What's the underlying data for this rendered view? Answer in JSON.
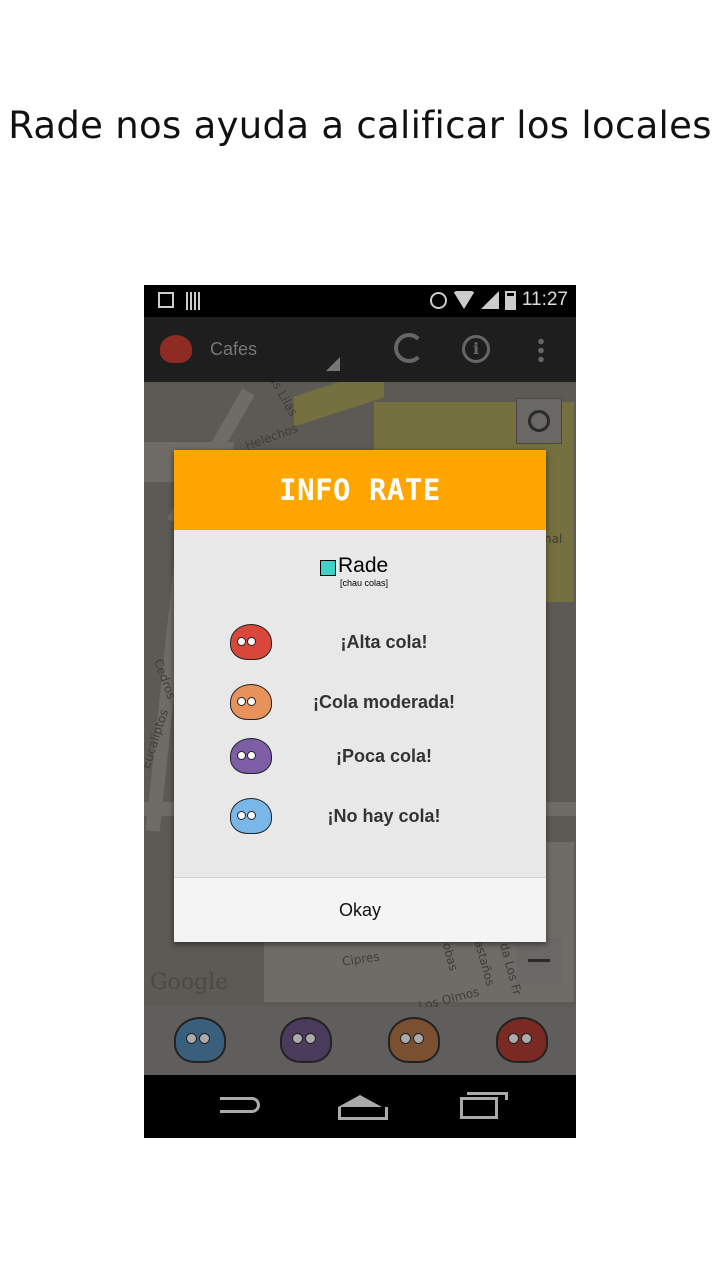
{
  "caption": "Rade nos ayuda a calificar los locales",
  "status_bar": {
    "time": "11:27",
    "icons": [
      "image-icon",
      "barcode-icon",
      "alarm-icon",
      "wifi-icon",
      "signal-icon",
      "battery-icon"
    ]
  },
  "action_bar": {
    "title": "Cafes",
    "icons": [
      "rade-logo-icon",
      "refresh-icon",
      "info-icon",
      "overflow-menu-icon"
    ]
  },
  "map": {
    "labels": [
      "Las Lilas",
      "Helechos",
      "Cipres",
      "Caobas",
      "Castaños",
      "Los Olmos",
      "Eucaliptos",
      "Cedros",
      "nal",
      "da Los Fr"
    ],
    "watermark": "Google"
  },
  "dialog": {
    "title": "INFO RATE",
    "brand": {
      "name": "Rade",
      "tagline": "[chau colas]"
    },
    "levels": [
      {
        "label": "¡Alta cola!",
        "color": "#d9473a",
        "mood": "angry"
      },
      {
        "label": "¡Cola moderada!",
        "color": "#e6925a",
        "mood": "annoyed"
      },
      {
        "label": "¡Poca cola!",
        "color": "#7d5ea6",
        "mood": "sleepy"
      },
      {
        "label": "¡No hay cola!",
        "color": "#79b7e8",
        "mood": "happy"
      }
    ],
    "ok_label": "Okay"
  },
  "bottom_filters": [
    {
      "name": "no-queue",
      "color": "#3a5f7d"
    },
    {
      "name": "little-queue",
      "color": "#4a3a5c"
    },
    {
      "name": "moderate-queue",
      "color": "#7a5030"
    },
    {
      "name": "high-queue",
      "color": "#7a2a22"
    }
  ],
  "nav_bar": {
    "icons": [
      "back-icon",
      "home-icon",
      "recents-icon"
    ]
  }
}
